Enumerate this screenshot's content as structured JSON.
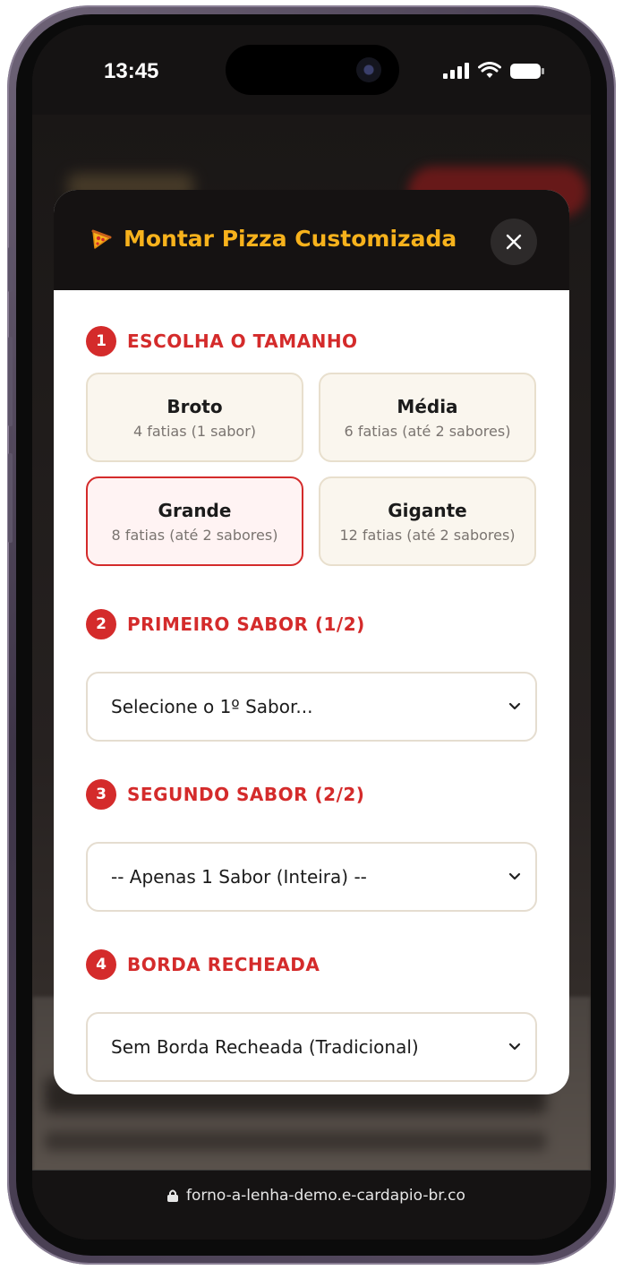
{
  "status_bar": {
    "time": "13:45"
  },
  "modal": {
    "title": "Montar Pizza Customizada",
    "close_icon": "close-icon",
    "pizza_icon": "pizza-slice-icon"
  },
  "steps": {
    "size": {
      "number": "1",
      "label": "ESCOLHA O TAMANHO"
    },
    "first_flavor": {
      "number": "2",
      "label": "PRIMEIRO SABOR (1/2)"
    },
    "second_flavor": {
      "number": "3",
      "label": "SEGUNDO SABOR (2/2)"
    },
    "crust": {
      "number": "4",
      "label": "BORDA RECHEADA"
    }
  },
  "sizes": [
    {
      "name": "Broto",
      "desc": "4 fatias (1 sabor)",
      "selected": false
    },
    {
      "name": "Média",
      "desc": "6 fatias (até 2 sabores)",
      "selected": false
    },
    {
      "name": "Grande",
      "desc": "8 fatias (até 2 sabores)",
      "selected": true
    },
    {
      "name": "Gigante",
      "desc": "12 fatias (até 2 sabores)",
      "selected": false
    }
  ],
  "selects": {
    "first_flavor": "Selecione o 1º Sabor...",
    "second_flavor": "-- Apenas 1 Sabor (Inteira) --",
    "crust": "Sem Borda Recheada (Tradicional)"
  },
  "browser": {
    "url": "forno-a-lenha-demo.e-cardapio-br.co"
  },
  "colors": {
    "accent_red": "#d42b2b",
    "title_gold": "#f7b21c",
    "header_dark": "#151212"
  }
}
